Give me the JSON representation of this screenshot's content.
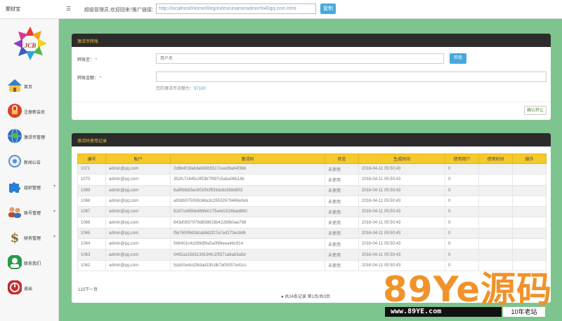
{
  "header": {
    "brand": "聚财宝",
    "menu_toggle": "☰",
    "welcome": "超级管理员,欢迎回来！",
    "promo_label": "推广链接：",
    "promo_link": "http://localhost/Home/Reg/index/uname/admin%40qq.com.html",
    "copy_button": "复制"
  },
  "sidebar": {
    "items": [
      {
        "label": "首页",
        "icon": "home-icon",
        "color": "#3a7fc4"
      },
      {
        "label": "注册新会员",
        "icon": "lock-icon",
        "color": "#d9432b"
      },
      {
        "label": "激活币管理",
        "icon": "globe-icon",
        "color": "#2b6fb8"
      },
      {
        "label": "新闻公告",
        "icon": "news-icon",
        "color": "#5b8fd1"
      },
      {
        "label": "组织管理",
        "icon": "puzzle-icon",
        "color": "#2a7fd4"
      },
      {
        "label": "账号管理",
        "icon": "users-icon",
        "color": "#c04a2a"
      },
      {
        "label": "财务管理",
        "icon": "dollar-icon",
        "color": "#8a6a2a"
      },
      {
        "label": "联系我们",
        "icon": "contact-icon",
        "color": "#2a9a4a"
      },
      {
        "label": "退出",
        "icon": "power-icon",
        "color": "#c03030"
      }
    ]
  },
  "transfer": {
    "title": "激活币转账",
    "to_label": "转账至：",
    "to_placeholder": "用户名",
    "check_button": "检查",
    "amount_label": "转账金额：",
    "balance_prefix": "您的激活币余额为：",
    "balance_value": "97100",
    "confirm_button": "确认转让"
  },
  "records": {
    "title": "激活码使用记录",
    "columns": [
      "编号",
      "账户",
      "激活码",
      "状态",
      "生成时间",
      "使用用户",
      "使用时间",
      "操作"
    ],
    "rows": [
      [
        "1071",
        "admin@qq.com",
        "2d6b4f18a6dab83b5517ceed9a64f366",
        "未使用",
        "2016-04-11 05:50:43",
        "0",
        "",
        ""
      ],
      [
        "1070",
        "admin@qq.com",
        "352fc71645c3f53b7f997c5aba06b14b",
        "未使用",
        "2016-04-11 05:50:43",
        "0",
        "",
        ""
      ],
      [
        "1069",
        "admin@qq.com",
        "6a85b6d3ec901f0cfff33dc6c568d602",
        "未使用",
        "2016-04-11 05:50:43",
        "0",
        "",
        ""
      ],
      [
        "1068",
        "admin@qq.com",
        "a63db075059c66a3c29532679466e0eb",
        "未使用",
        "2016-04-11 05:50:43",
        "0",
        "",
        ""
      ],
      [
        "1067",
        "admin@qq.com",
        "8187cd45bb486fe0175a4d1526bad890",
        "未使用",
        "2016-04-11 05:50:43",
        "0",
        "",
        ""
      ],
      [
        "1066",
        "admin@qq.com",
        "843d0837979d858615b42289b0ae768",
        "未使用",
        "2016-04-11 05:50:43",
        "0",
        "",
        ""
      ],
      [
        "1065",
        "admin@qq.com",
        "f5b76099d3dcab8d2f27a7ed273ec8d6",
        "未使用",
        "2016-04-11 05:50:43",
        "0",
        "",
        ""
      ],
      [
        "1064",
        "admin@qq.com",
        "566401c4cb59df9a5a0f89eea4bc914",
        "未使用",
        "2016-04-11 05:50:43",
        "0",
        "",
        ""
      ],
      [
        "1063",
        "admin@qq.com",
        "0492a115b513913f4c1f5571a6ab3a5d",
        "未使用",
        "2016-04-11 05:50:43",
        "0",
        "",
        ""
      ],
      [
        "1062",
        "admin@qq.com",
        "5da50e4cd28dad33fcdb7a05057e41cc",
        "未使用",
        "2016-04-11 05:50:43",
        "0",
        "",
        ""
      ]
    ],
    "pager_left": "123下一页",
    "pager_summary": "共24条记录 第1页/共3页"
  },
  "watermark": {
    "big": "89Ye源码",
    "url": "www.89YE.com",
    "tag": "10年老站"
  }
}
